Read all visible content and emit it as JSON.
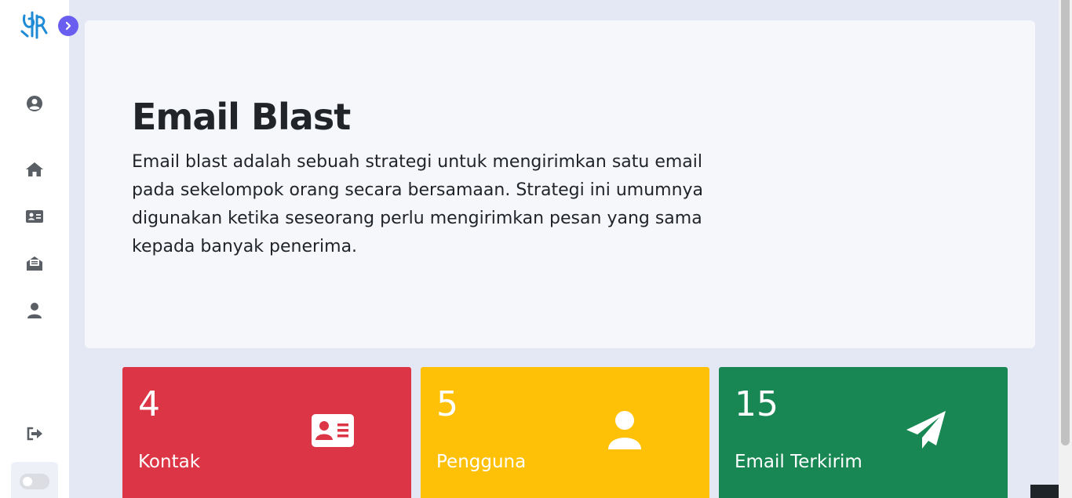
{
  "sidebar": {
    "logo": "dp-logo-icon",
    "toggle_icon": "chevron-right-icon",
    "nav": [
      "user-circle-icon",
      "home-icon",
      "contact-card-icon",
      "envelope-open-icon",
      "user-icon"
    ],
    "logout_icon": "sign-out-icon",
    "theme_toggle_state": "off"
  },
  "hero": {
    "title": "Email Blast",
    "description": "Email blast adalah sebuah strategi untuk mengirimkan satu email pada sekelompok orang secara bersamaan. Strategi ini umumnya digunakan ketika seseorang perlu mengirimkan pesan yang sama kepada banyak penerima."
  },
  "stats": [
    {
      "value": "4",
      "label": "Kontak",
      "icon": "contact-card-icon",
      "color": "#dc3545"
    },
    {
      "value": "5",
      "label": "Pengguna",
      "icon": "user-icon",
      "color": "#ffc107"
    },
    {
      "value": "15",
      "label": "Email Terkirim",
      "icon": "paper-plane-icon",
      "color": "#198754"
    }
  ],
  "colors": {
    "accent": "#6a5ef0",
    "logo": "#1f8ad6",
    "icon_gray": "#5a5f66",
    "background": "#e3e8f4"
  }
}
